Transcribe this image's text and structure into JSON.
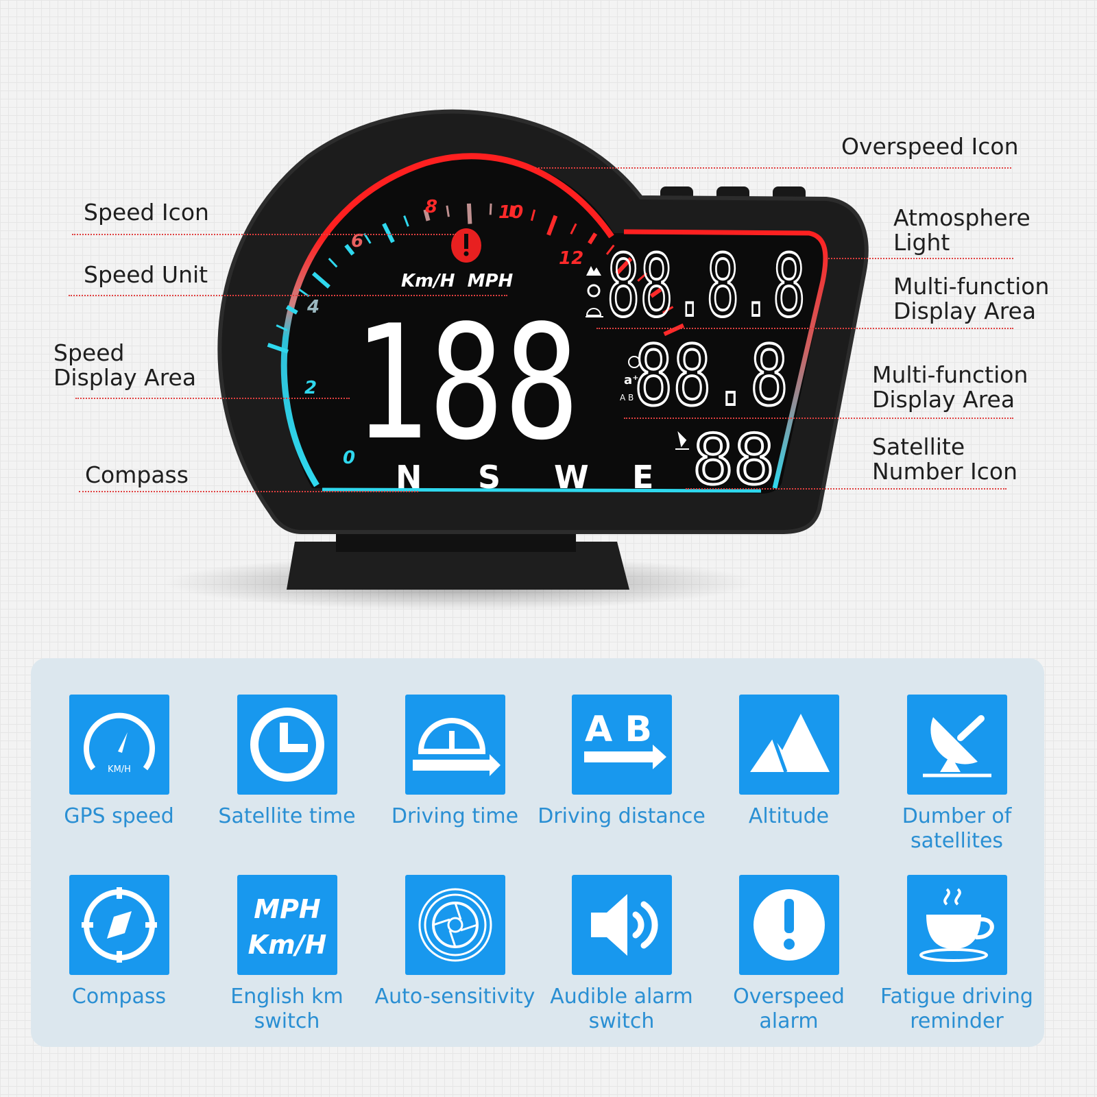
{
  "device": {
    "gauge_numbers": [
      "0",
      "2",
      "4",
      "6",
      "8",
      "10",
      "12"
    ],
    "speed_units": "Km/H  MPH",
    "speed_value": "188",
    "display_top": "88.8.8",
    "display_mid": "88.8",
    "satellite_count": "88",
    "compass": [
      "N",
      "S",
      "W",
      "E"
    ],
    "colors": {
      "red": "#ff2020",
      "cyan": "#2fd8ee",
      "screen": "#0b0b0b"
    }
  },
  "callouts": [
    {
      "text": "Overspeed Icon"
    },
    {
      "text": "Speed Icon"
    },
    {
      "text": "Speed Unit"
    },
    {
      "text": "Speed\nDisplay Area"
    },
    {
      "text": "Compass"
    },
    {
      "text": "Atmosphere\nLight"
    },
    {
      "text": "Multi-function\nDisplay Area"
    },
    {
      "text": "Multi-function\nDisplay Area"
    },
    {
      "text": "Satellite\nNumber Icon"
    }
  ],
  "features": [
    {
      "label": "GPS speed",
      "icon": "speedometer-icon",
      "icon_text": "KM/H"
    },
    {
      "label": "Satellite time",
      "icon": "clock-icon"
    },
    {
      "label": "Driving time",
      "icon": "driving-time-icon"
    },
    {
      "label": "Driving distance",
      "icon": "ab-distance-icon",
      "icon_text": "A B"
    },
    {
      "label": "Altitude",
      "icon": "mountain-icon"
    },
    {
      "label": "Dumber of\nsatellites",
      "icon": "satellite-dish-icon"
    },
    {
      "label": "Compass",
      "icon": "compass-icon"
    },
    {
      "label": "English km\nswitch",
      "icon": "unit-switch-icon",
      "icon_text": [
        "MPH",
        "Km/H"
      ]
    },
    {
      "label": "Auto-sensitivity",
      "icon": "aperture-icon"
    },
    {
      "label": "Audible alarm\nswitch",
      "icon": "speaker-icon"
    },
    {
      "label": "Overspeed\nalarm",
      "icon": "alert-icon"
    },
    {
      "label": "Fatigue driving\nreminder",
      "icon": "coffee-cup-icon"
    }
  ],
  "accent": "#1898ee"
}
